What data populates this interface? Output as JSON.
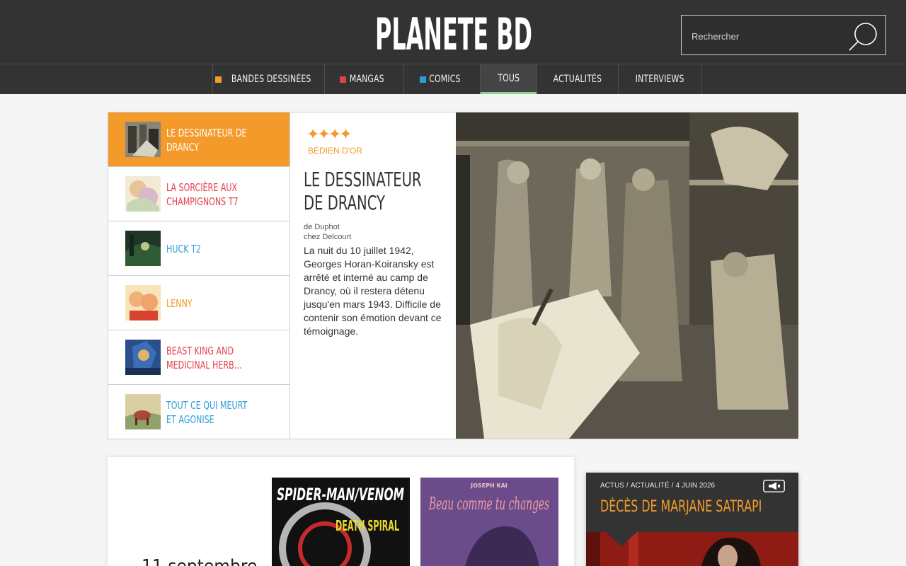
{
  "header": {
    "logo_text": "PLANETE BD",
    "search": {
      "placeholder": "Rechercher"
    }
  },
  "nav": {
    "items": [
      {
        "label": "Bandes dessinées",
        "color": "#f39a2b"
      },
      {
        "label": "Mangas",
        "color": "#e2424f"
      },
      {
        "label": "Comics",
        "color": "#2f9ed8"
      },
      {
        "label": "Tous",
        "active": true
      },
      {
        "label": "Actualités"
      },
      {
        "label": "Interviews"
      }
    ]
  },
  "featured": {
    "list": [
      {
        "title": "Le dessinateur de Drancy",
        "color": "#ffffff",
        "selected": true
      },
      {
        "title": "La sorcière aux champignons T7",
        "color": "#e2424f"
      },
      {
        "title": "Huck T2",
        "color": "#2f9ed8"
      },
      {
        "title": "Lenny",
        "color": "#f39a2b"
      },
      {
        "title": "Beast King and Medicinal Herb…",
        "color": "#e2424f"
      },
      {
        "title": "Tout ce qui meurt et agonise",
        "color": "#2f9ed8"
      }
    ],
    "detail": {
      "stars": "✦✦✦✦",
      "rating_count": 4,
      "award": "BÉDIEN D'OR",
      "title": "LE DESSINATEUR DE DRANCY",
      "author_prefix": "de",
      "author": "Duphot",
      "publisher_prefix": "chez",
      "publisher": "Delcourt",
      "description": "La nuit du 10 juillet 1942, Georges Horan-Koiransky est arrêté et interné au camp de Drancy, où il restera détenu jusqu'en mars 1943. Difficile de contenir son émotion devant ce témoignage."
    }
  },
  "releases": {
    "date_label": "11 septembre",
    "covers": [
      {
        "title": "SPIDER-MAN/VENOM",
        "subtitle": "DEATH SPIRAL"
      },
      {
        "author": "JOSEPH KAI",
        "title": "Beau comme tu changes"
      }
    ]
  },
  "news": {
    "category": "Actus",
    "subcategory": "Actualité",
    "date": "4 juin 2026",
    "title": "Décès de Marjane Satrapi",
    "icon": "megaphone-icon"
  },
  "colors": {
    "accent_orange": "#f39a2b",
    "accent_red": "#e2424f",
    "accent_blue": "#2f9ed8",
    "header_bg": "#333333",
    "active_underline": "#8fd08f"
  }
}
